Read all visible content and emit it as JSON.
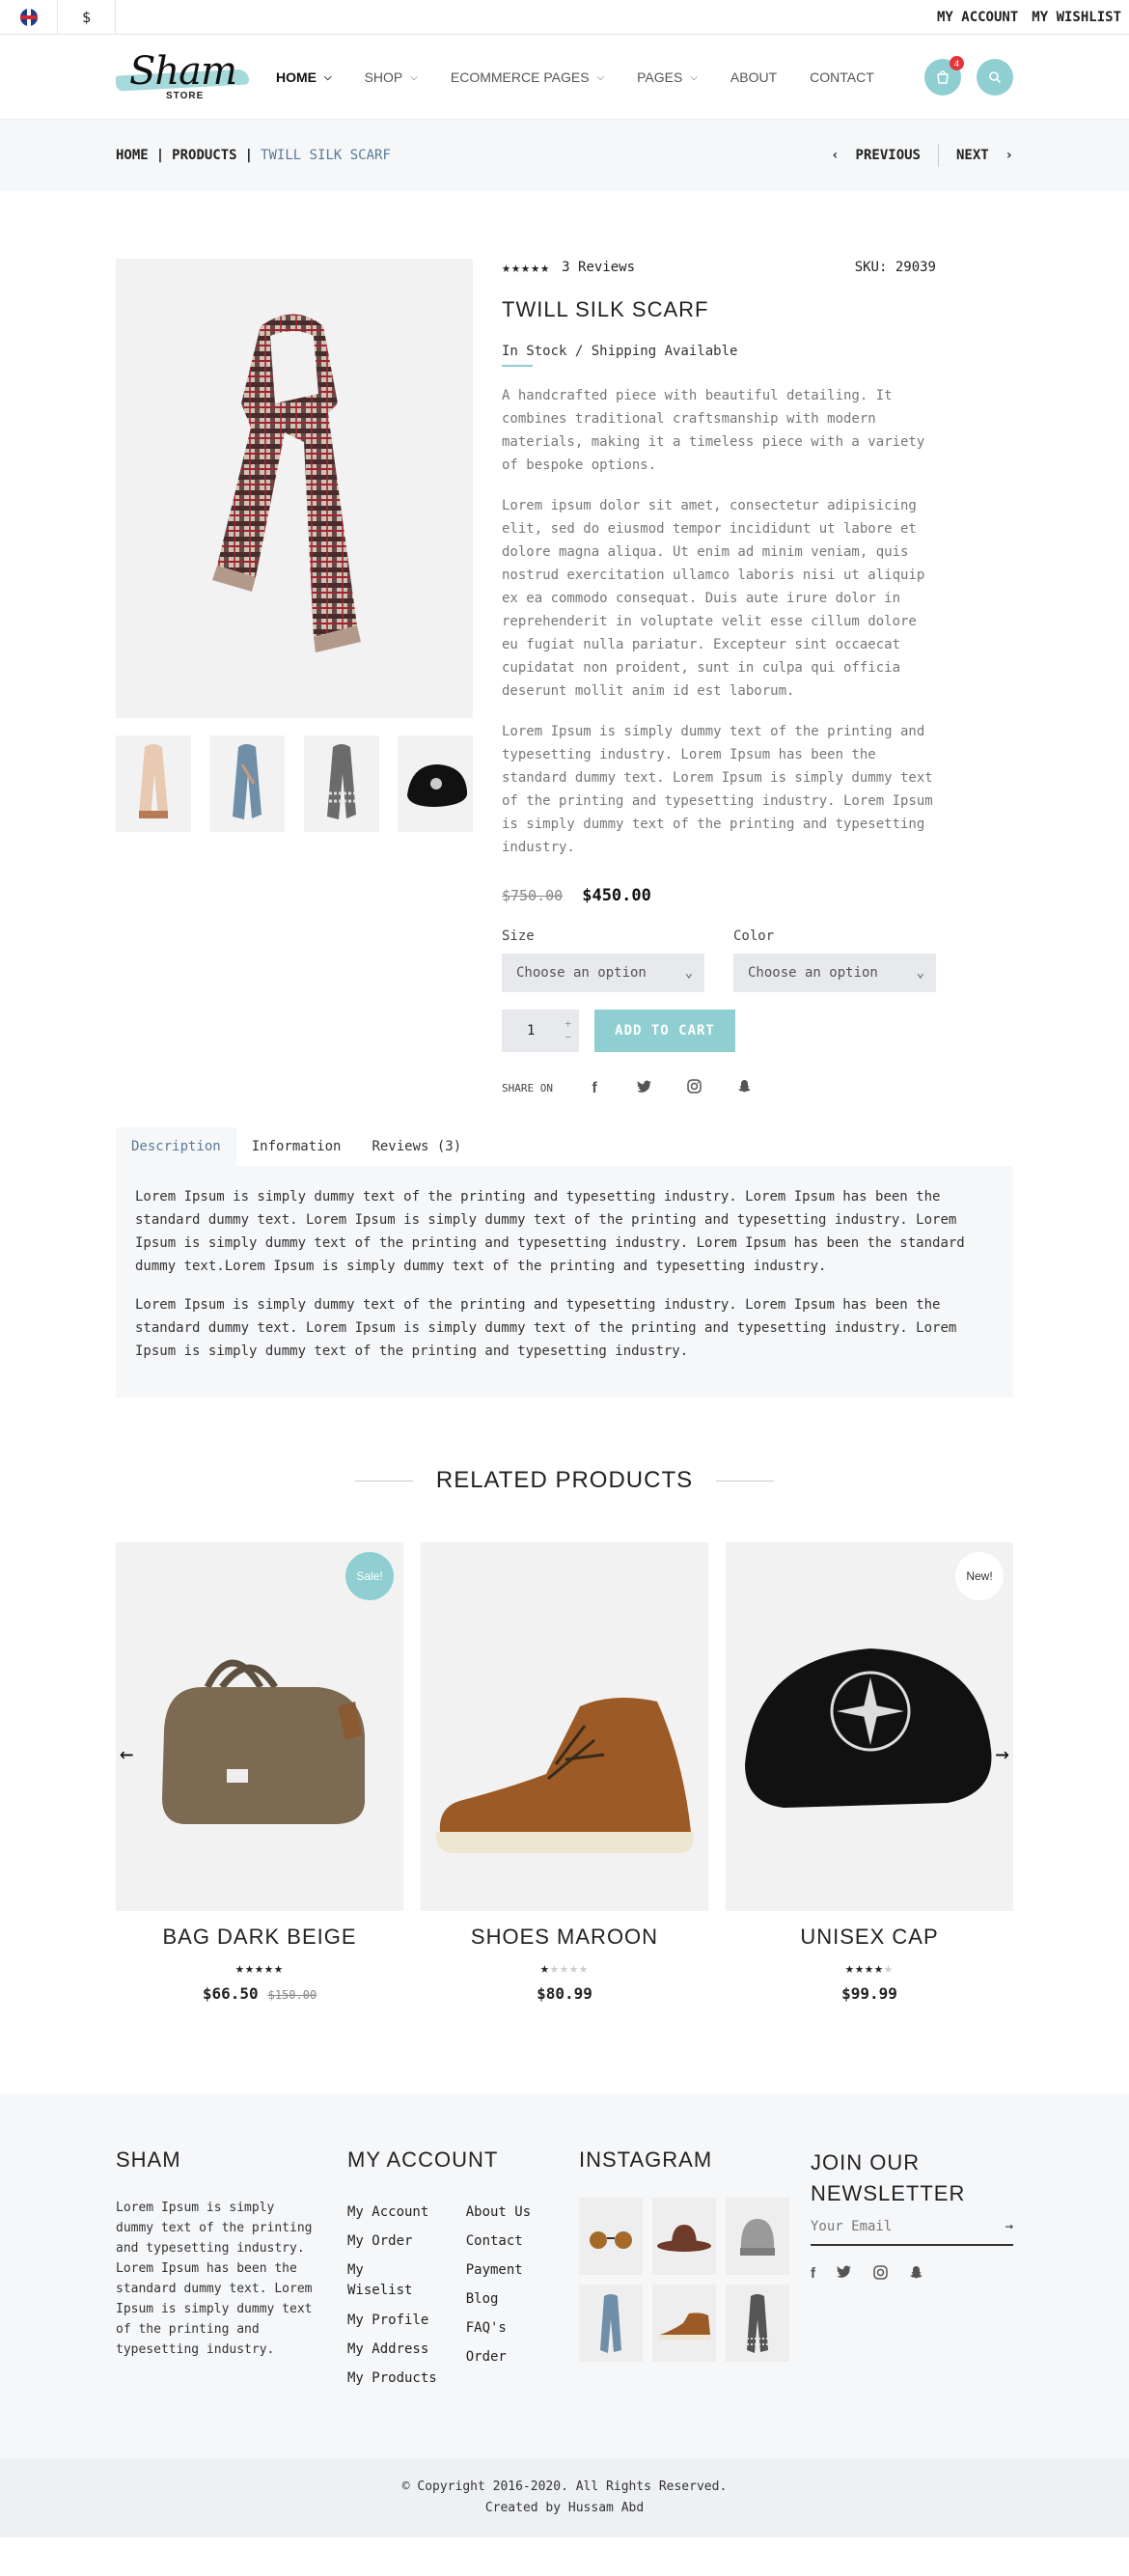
{
  "topbar": {
    "currency": "$",
    "links": [
      "MY ACCOUNT",
      "MY WISHLIST"
    ]
  },
  "header": {
    "logo_text": "Sham",
    "logo_sub": "STORE",
    "nav": [
      {
        "label": "HOME",
        "dropdown": true,
        "active": true
      },
      {
        "label": "SHOP",
        "dropdown": true
      },
      {
        "label": "ECOMMERCE PAGES",
        "dropdown": true
      },
      {
        "label": "PAGES",
        "dropdown": true
      },
      {
        "label": "ABOUT",
        "dropdown": false
      },
      {
        "label": "CONTACT",
        "dropdown": false
      }
    ],
    "cart_count": "4"
  },
  "breadcrumb": {
    "home": "HOME",
    "products": "PRODUCTS",
    "current": "TWILL SILK SCARF",
    "previous": "PREVIOUS",
    "next": "NEXT"
  },
  "product": {
    "rating": 4.5,
    "reviews": "3 Reviews",
    "sku": "SKU: 29039",
    "title": "TWILL SILK SCARF",
    "stock": "In Stock / Shipping Available",
    "desc1": "A handcrafted piece with beautiful detailing. It combines traditional craftsmanship with modern materials, making it a timeless piece with a variety of bespoke options.",
    "desc2": "Lorem ipsum dolor sit amet, consectetur adipisicing elit, sed do eiusmod tempor incididunt ut labore et dolore magna aliqua. Ut enim ad minim veniam, quis nostrud exercitation ullamco laboris nisi ut aliquip ex ea commodo consequat. Duis aute irure dolor in reprehenderit in voluptate velit esse cillum dolore eu fugiat nulla pariatur. Excepteur sint occaecat cupidatat non proident, sunt in culpa qui officia deserunt mollit anim id est laborum.",
    "desc3": "Lorem Ipsum is simply dummy text of the printing and typesetting industry. Lorem Ipsum has been the standard dummy text. Lorem Ipsum is simply dummy text of the printing and typesetting industry. Lorem Ipsum is simply dummy text of the printing and typesetting industry.",
    "old_price": "$750.00",
    "price": "$450.00",
    "size_label": "Size",
    "color_label": "Color",
    "size_value": "Choose an option",
    "color_value": "Choose an option",
    "qty": "1",
    "add_to_cart": "ADD TO CART",
    "share_label": "SHARE ON",
    "share_icons": [
      "facebook-icon",
      "twitter-icon",
      "instagram-icon",
      "snapchat-icon"
    ]
  },
  "tabs": {
    "labels": [
      "Description",
      "Information",
      "Reviews (3)"
    ],
    "body1": "Lorem Ipsum is simply dummy text of the printing and typesetting industry. Lorem Ipsum has been the standard dummy text. Lorem Ipsum is simply dummy text of the printing and typesetting industry. Lorem Ipsum is simply dummy text of the printing and typesetting industry. Lorem Ipsum has been the standard dummy text.Lorem Ipsum is simply dummy text of the printing and typesetting industry.",
    "body2": "Lorem Ipsum is simply dummy text of the printing and typesetting industry. Lorem Ipsum has been the standard dummy text. Lorem Ipsum is simply dummy text of the printing and typesetting industry. Lorem Ipsum is simply dummy text of the printing and typesetting industry."
  },
  "related": {
    "heading": "RELATED PRODUCTS",
    "items": [
      {
        "name": "BAG DARK BEIGE",
        "price": "$66.50",
        "old_price": "$150.00",
        "rating": 4.5,
        "badge": "Sale!"
      },
      {
        "name": "SHOES MAROON",
        "price": "$80.99",
        "old_price": "",
        "rating": 1,
        "badge": ""
      },
      {
        "name": "UNISEX CAP",
        "price": "$99.99",
        "old_price": "",
        "rating": 3.5,
        "badge": "New!"
      }
    ]
  },
  "footer": {
    "about_title": "SHAM",
    "about_text": "Lorem Ipsum is simply dummy text of the printing and typesetting industry. Lorem Ipsum has been the standard dummy text. Lorem Ipsum is simply dummy text of the printing and typesetting industry.",
    "account_title": "MY ACCOUNT",
    "account_col1": [
      "My Account",
      "My Order",
      "My Wiselist",
      "My Profile",
      "My Address",
      "My Products"
    ],
    "account_col2": [
      "About Us",
      "Contact",
      "Payment",
      "Blog",
      "FAQ's",
      "Order"
    ],
    "instagram_title": "INSTAGRAM",
    "newsletter_title": "JOIN OUR NEWSLETTER",
    "email_placeholder": "Your Email",
    "copyright": "© Copyright 2016-2020. All Rights Reserved.",
    "created_by": "Created by Hussam Abd"
  },
  "colors": {
    "accent": "#8fcfd1",
    "badge_red": "#e6343b",
    "light_bg": "#f6f7f9"
  }
}
